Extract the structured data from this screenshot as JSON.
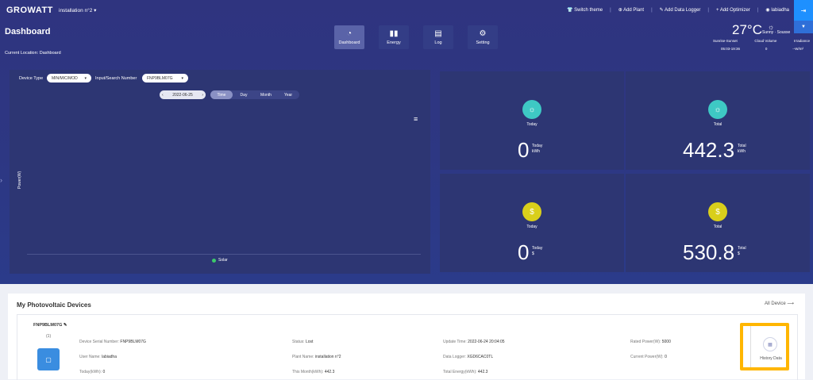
{
  "nav": {
    "logo": "GROWATT",
    "plant": "installation n°2",
    "switch_theme": "Switch theme",
    "add_plant": "Add Plant",
    "add_logger": "Add Data Logger",
    "add_optimizer": "Add Optimizer",
    "user": "labiadha"
  },
  "header": {
    "title": "Dashboard",
    "crumb": "Current Location: Dashboard",
    "tabs": [
      {
        "label": "Dashboard",
        "icon": "gauge-icon"
      },
      {
        "label": "Energy",
        "icon": "bar-chart-icon"
      },
      {
        "label": "Log",
        "icon": "log-icon"
      },
      {
        "label": "Setting",
        "icon": "gear-icon"
      }
    ]
  },
  "weather": {
    "temp": "27°C",
    "condition": "Sunny · Sousse",
    "sunrise_label": "Sunrise-Sunset",
    "cloud_label": "Cloud Volume",
    "irr_label": "Irradiance",
    "sunrise_value": "05:03-19:36",
    "cloud_value": "0",
    "irr_value": "--W/m²"
  },
  "chart": {
    "device_type_label": "Device Type",
    "device_type_value": "MIN/MIC/MOD",
    "search_label": "Input/Search Number",
    "search_value": "FNP9BLM07G",
    "date": "2022-06-25",
    "ranges": [
      "Time",
      "Day",
      "Month",
      "Year"
    ],
    "ylabel": "Power(W)",
    "legend": "Solar"
  },
  "chart_data": {
    "type": "line",
    "ylabel": "Power(W)",
    "series": [
      {
        "name": "Solar",
        "values": []
      }
    ]
  },
  "stats": [
    {
      "label": "Today",
      "value": "0",
      "unit_top": "Today",
      "unit": "kWh",
      "icon": "sun-icon",
      "color": "#3ec9c4"
    },
    {
      "label": "Total",
      "value": "442.3",
      "unit_top": "Total",
      "unit": "kWh",
      "icon": "sun-icon",
      "color": "#3ec9c4"
    },
    {
      "label": "Today",
      "value": "0",
      "unit_top": "Today",
      "unit": "$",
      "icon": "coin-icon",
      "color": "#d9cf1b"
    },
    {
      "label": "Total",
      "value": "530.8",
      "unit_top": "Total",
      "unit": "$",
      "icon": "coin-icon",
      "color": "#d9cf1b"
    }
  ],
  "devices": {
    "title": "My Photovoltaic Devices",
    "all_device": "All Device",
    "id": "FNP9BLM07G",
    "count": "(1)",
    "serial_label": "Device Serial Number:",
    "serial_value": "FNP9BLM07G",
    "user_label": "User Name:",
    "user_value": "labiadha",
    "today_label": "Today(kWh):",
    "today_value": "0",
    "status_label": "Status:",
    "status_value": "Lost",
    "plant_label": "Plant Name:",
    "plant_value": "installation n°2",
    "month_label": "This Month(kWh):",
    "month_value": "442.3",
    "update_label": "Update Time:",
    "update_value": "2022-06-24 20:04:05",
    "logger_label": "Data Logger:",
    "logger_value": "XGD6CAC0TL",
    "total_label": "Total Energy(kWh):",
    "total_value": "442.3",
    "rated_label": "Rated Power(W):",
    "rated_value": "5000",
    "current_label": "Current Power(W):",
    "current_value": "0",
    "history": "History Data"
  }
}
